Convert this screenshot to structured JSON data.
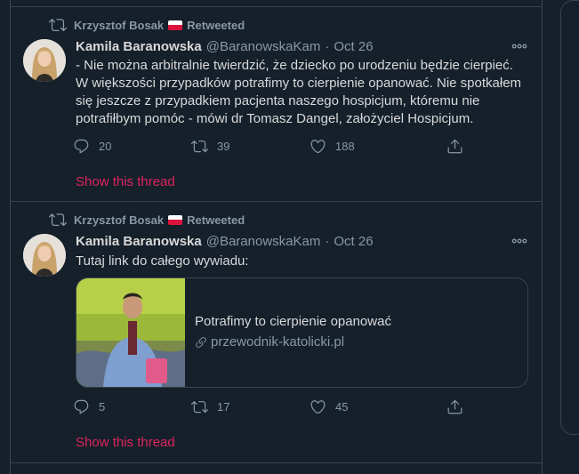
{
  "tweets": [
    {
      "retweeter": "Krzysztof Bosak",
      "retweeted_label": "Retweeted",
      "author_name": "Kamila Baranowska",
      "author_handle": "@BaranowskaKam",
      "dot": "·",
      "date": "Oct 26",
      "text": "- Nie można arbitralnie twierdzić, że dziecko po urodzeniu będzie cierpieć. W większości przypadków potrafimy to cierpienie opanować. Nie spotkałem się jeszcze z przypadkiem pacjenta naszego hospicjum, któremu nie potrafiłbym pomóc - mówi dr Tomasz Dangel, założyciel Hospicjum.",
      "replies": "20",
      "retweets": "39",
      "likes": "188",
      "show_thread": "Show this thread"
    },
    {
      "retweeter": "Krzysztof Bosak",
      "retweeted_label": "Retweeted",
      "author_name": "Kamila Baranowska",
      "author_handle": "@BaranowskaKam",
      "dot": "·",
      "date": "Oct 26",
      "text": "Tutaj link do całego wywiadu:",
      "card": {
        "title": "Potrafimy to cierpienie opanować",
        "domain": "przewodnik-katolicki.pl"
      },
      "replies": "5",
      "retweets": "17",
      "likes": "45",
      "show_thread": "Show this thread"
    }
  ],
  "icons": {
    "retweet": "retweet-icon",
    "reply": "reply-icon",
    "like": "heart-icon",
    "share": "share-icon",
    "more": "more-icon",
    "link": "link-icon",
    "flag": "poland-flag-icon"
  },
  "colors": {
    "background": "#15202b",
    "border": "#38444d",
    "text": "#d9d9d9",
    "muted": "#8899a6",
    "accent": "#e0245e"
  }
}
